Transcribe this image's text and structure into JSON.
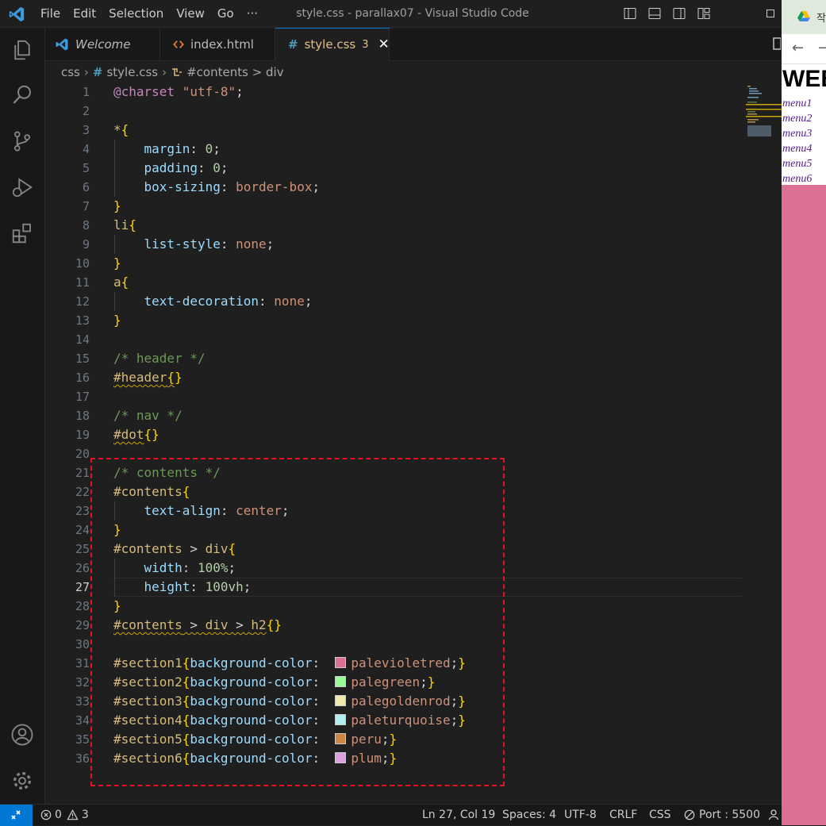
{
  "titlebar": {
    "menu": [
      "File",
      "Edit",
      "Selection",
      "View",
      "Go",
      "···"
    ],
    "title": "style.css - parallax07 - Visual Studio Code"
  },
  "tabs": [
    {
      "label": "Welcome"
    },
    {
      "label": "index.html"
    },
    {
      "label": "style.css",
      "badge": "3",
      "close": "✕"
    }
  ],
  "breadcrumb": {
    "folder": "css",
    "file": "style.css",
    "symbol": "#contents > div"
  },
  "editor": {
    "line_numbers": [
      "1",
      "2",
      "3",
      "4",
      "5",
      "6",
      "7",
      "8",
      "9",
      "10",
      "11",
      "12",
      "13",
      "14",
      "15",
      "16",
      "17",
      "18",
      "19",
      "20",
      "21",
      "22",
      "23",
      "24",
      "25",
      "26",
      "27",
      "28",
      "29",
      "30",
      "31",
      "32",
      "33",
      "34",
      "35",
      "36"
    ],
    "active_line": 27,
    "tokens": {
      "charset_kw": "@charset",
      "charset_val": "\"utf-8\"",
      "semi": ";",
      "star": "*",
      "brace_open": "{",
      "brace_close": "}",
      "margin": "margin",
      "padding": "padding",
      "box_sizing": "box-sizing",
      "border_box": "border-box",
      "zero": "0",
      "li": "li",
      "list_style": "list-style",
      "none": "none",
      "a": "a",
      "text_decoration": "text-decoration",
      "cm_header": "/* header */",
      "sel_header": "#header",
      "cm_nav": "/* nav */",
      "sel_dot": "#dot",
      "cm_contents": "/* contents */",
      "sel_contents": "#contents",
      "text_align": "text-align",
      "center": "center",
      "gt": " > ",
      "div": "div",
      "h2": "h2",
      "width": "width",
      "w100": "100%",
      "height": "height",
      "h100vh": "100vh",
      "colon": ": ",
      "bg_color": "background-color"
    },
    "sections": [
      {
        "selector": "#section1",
        "value": "palevioletred",
        "color": "#db7093"
      },
      {
        "selector": "#section2",
        "value": "palegreen",
        "color": "#98fb98"
      },
      {
        "selector": "#section3",
        "value": "palegoldenrod",
        "color": "#eee8aa"
      },
      {
        "selector": "#section4",
        "value": "paleturquoise",
        "color": "#afeeee"
      },
      {
        "selector": "#section5",
        "value": "peru",
        "color": "#cd853f"
      },
      {
        "selector": "#section6",
        "value": "plum",
        "color": "#dda0dd"
      }
    ]
  },
  "statusbar": {
    "errors": "0",
    "warnings": "3",
    "position": "Ln 27, Col 19",
    "spaces": "Spaces: 4",
    "encoding": "UTF-8",
    "eol": "CRLF",
    "language": "CSS",
    "port": "Port : 5500"
  },
  "browser": {
    "tab_label": "작",
    "heading": "WEB",
    "menu": [
      "menu1",
      "menu2",
      "menu3",
      "menu4",
      "menu5",
      "menu6"
    ]
  },
  "colors": {
    "accent": "#0078d4",
    "page_background": "#db7093",
    "annotation_border": "#e81123"
  }
}
